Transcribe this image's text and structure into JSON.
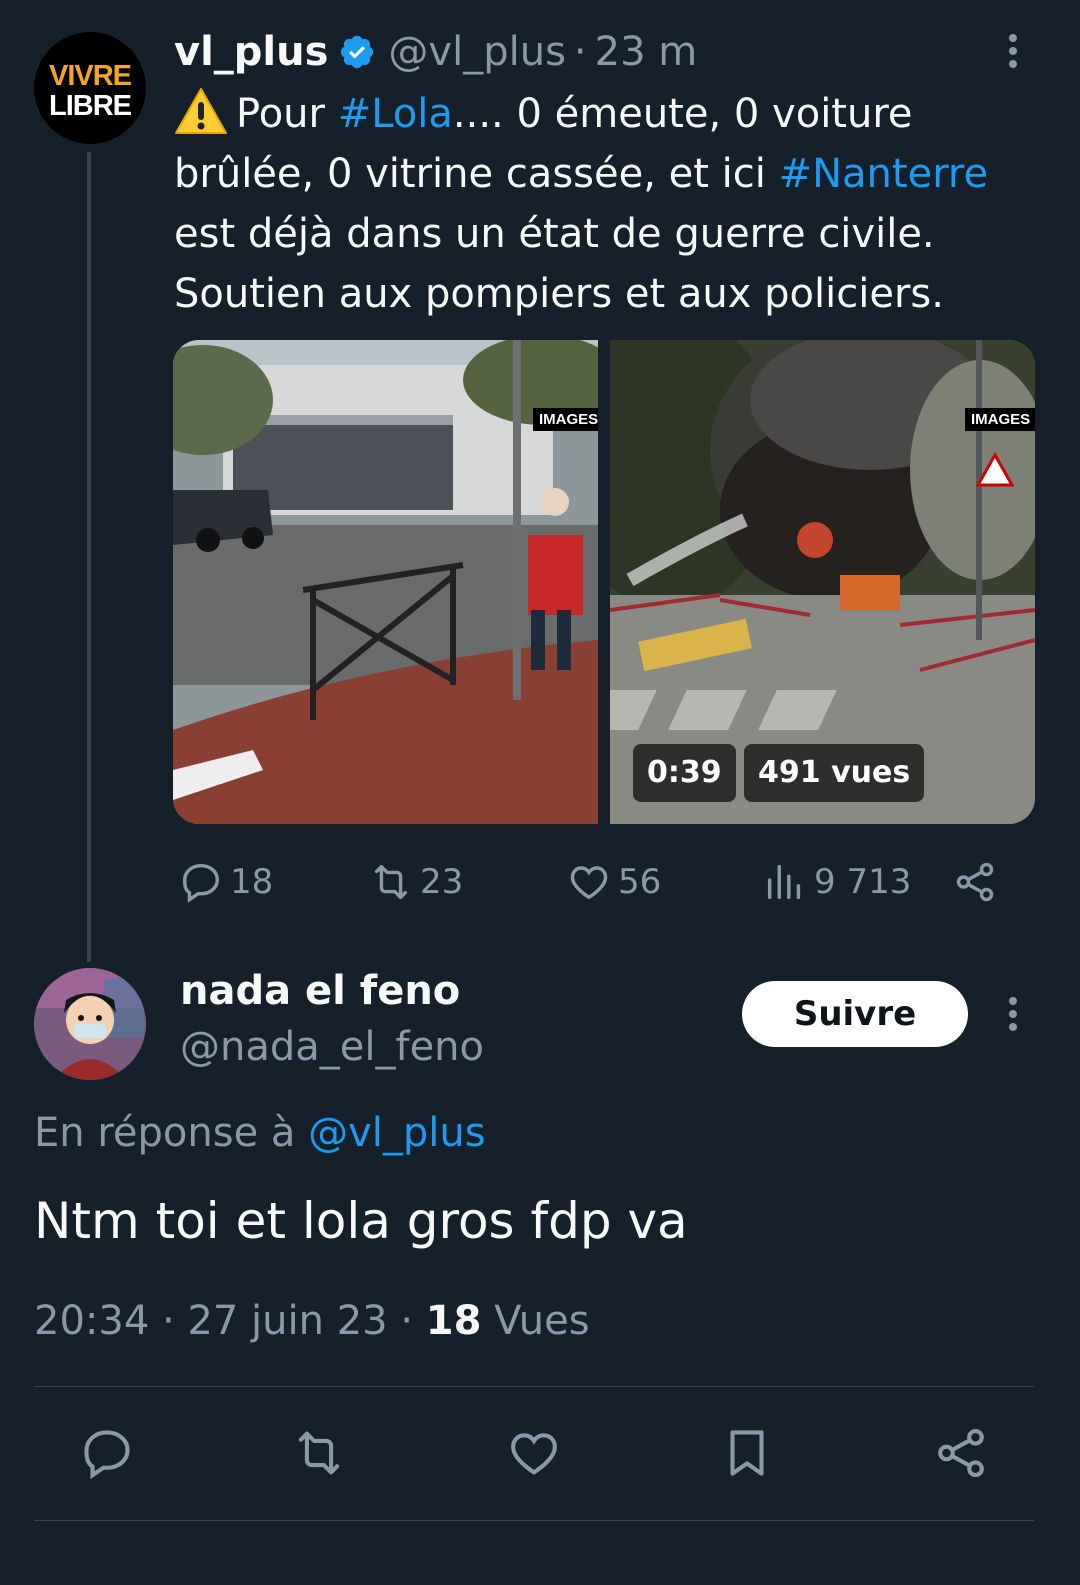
{
  "parent_tweet": {
    "avatar_text_line1": "VIVRE",
    "avatar_text_line2": "LIBRE",
    "display_name": "vl_plus",
    "handle": "@vl_plus",
    "separator": "·",
    "time": "23 m",
    "text_parts": {
      "p1": "Pour ",
      "hashtag1": "#Lola",
      "p2": ".... 0 émeute, 0 voiture brûlée, 0 vitrine cassée, et ici ",
      "hashtag2": "#Nanterre",
      "p3": " est déjà dans un état de guerre civile. Soutien aux pompiers et aux policiers."
    },
    "media": {
      "watermark_1": "IMAGES",
      "watermark_2": "IMAGES",
      "duration": "0:39",
      "views": "491 vues"
    },
    "actions": {
      "replies": "18",
      "retweets": "23",
      "likes": "56",
      "views": "9 713"
    },
    "icons": [
      "warning-emoji-icon",
      "verified-badge-icon",
      "more-options-icon",
      "reply-icon",
      "retweet-icon",
      "like-icon",
      "views-icon",
      "share-icon"
    ]
  },
  "reply_tweet": {
    "display_name": "nada el feno",
    "handle": "@nada_el_feno",
    "follow_label": "Suivre",
    "reply_to_prefix": "En réponse à ",
    "reply_to_handle": "@vl_plus",
    "text": "Ntm toi et lola gros fdp va",
    "time": "20:34",
    "date": "27 juin 23",
    "sep": "·",
    "views_count": "18",
    "views_label": "Vues"
  },
  "bottom_bar": {
    "icons": [
      "reply-icon",
      "retweet-icon",
      "like-icon",
      "bookmark-icon",
      "share-icon"
    ]
  },
  "colors": {
    "background": "#15202b",
    "text": "#f7f9f9",
    "muted": "#8b98a5",
    "link": "#1d9bf0",
    "avatar_accent": "#f5a623"
  }
}
